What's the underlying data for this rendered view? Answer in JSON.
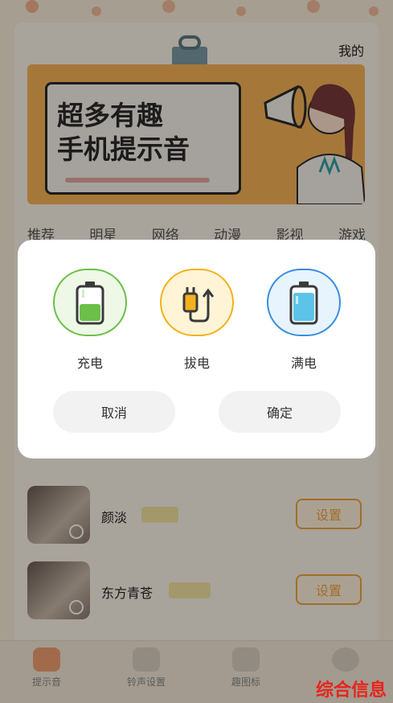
{
  "header": {
    "my_label": "我的"
  },
  "banner": {
    "title_line1": "超多有趣",
    "title_line2": "手机提示音"
  },
  "categories": [
    "推荐",
    "明星",
    "网络",
    "动漫",
    "影视",
    "游戏"
  ],
  "list": [
    {
      "name": "颜淡",
      "button": "设置"
    },
    {
      "name": "东方青苍",
      "button": "设置"
    }
  ],
  "bottom_nav": [
    {
      "label": "提示音"
    },
    {
      "label": "铃声设置"
    },
    {
      "label": "趣图标"
    }
  ],
  "watermark": "综合信息",
  "dialog": {
    "options": [
      {
        "label": "充电",
        "icon": "battery-charging-icon",
        "color": "#6cc04a",
        "bg": "#eef8e6"
      },
      {
        "label": "拔电",
        "icon": "unplug-icon",
        "color": "#f2b21e",
        "bg": "#fff4d6"
      },
      {
        "label": "满电",
        "icon": "battery-full-icon",
        "color": "#3a8ee0",
        "bg": "#e8f4fd"
      }
    ],
    "cancel_label": "取消",
    "confirm_label": "确定"
  }
}
